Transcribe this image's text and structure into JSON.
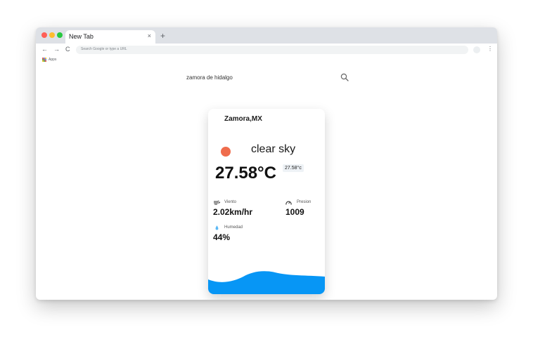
{
  "browser": {
    "tab": {
      "title": "New Tab",
      "close": "×"
    },
    "new_tab": "+",
    "toolbar": {
      "back": "←",
      "forward": "→",
      "reload": "C",
      "omnibox_placeholder": "Search Google or type a URL",
      "menu": "⋮"
    },
    "bookmarks": {
      "apps_label": "Apps"
    }
  },
  "search": {
    "query": "zamora de hidalgo",
    "icon": "search-icon"
  },
  "weather": {
    "city": "Zamora,MX",
    "description": "clear sky",
    "temperature": "27.58°C",
    "temperature_small": "27.58°c",
    "wind": {
      "label": "Viento",
      "value": "2.02km/hr"
    },
    "pressure": {
      "label": "Presion",
      "value": "1009"
    },
    "humidity": {
      "label": "Humedad",
      "value": "44%"
    },
    "colors": {
      "sun": "#ef6c4c",
      "wave": "#0796f5"
    }
  }
}
